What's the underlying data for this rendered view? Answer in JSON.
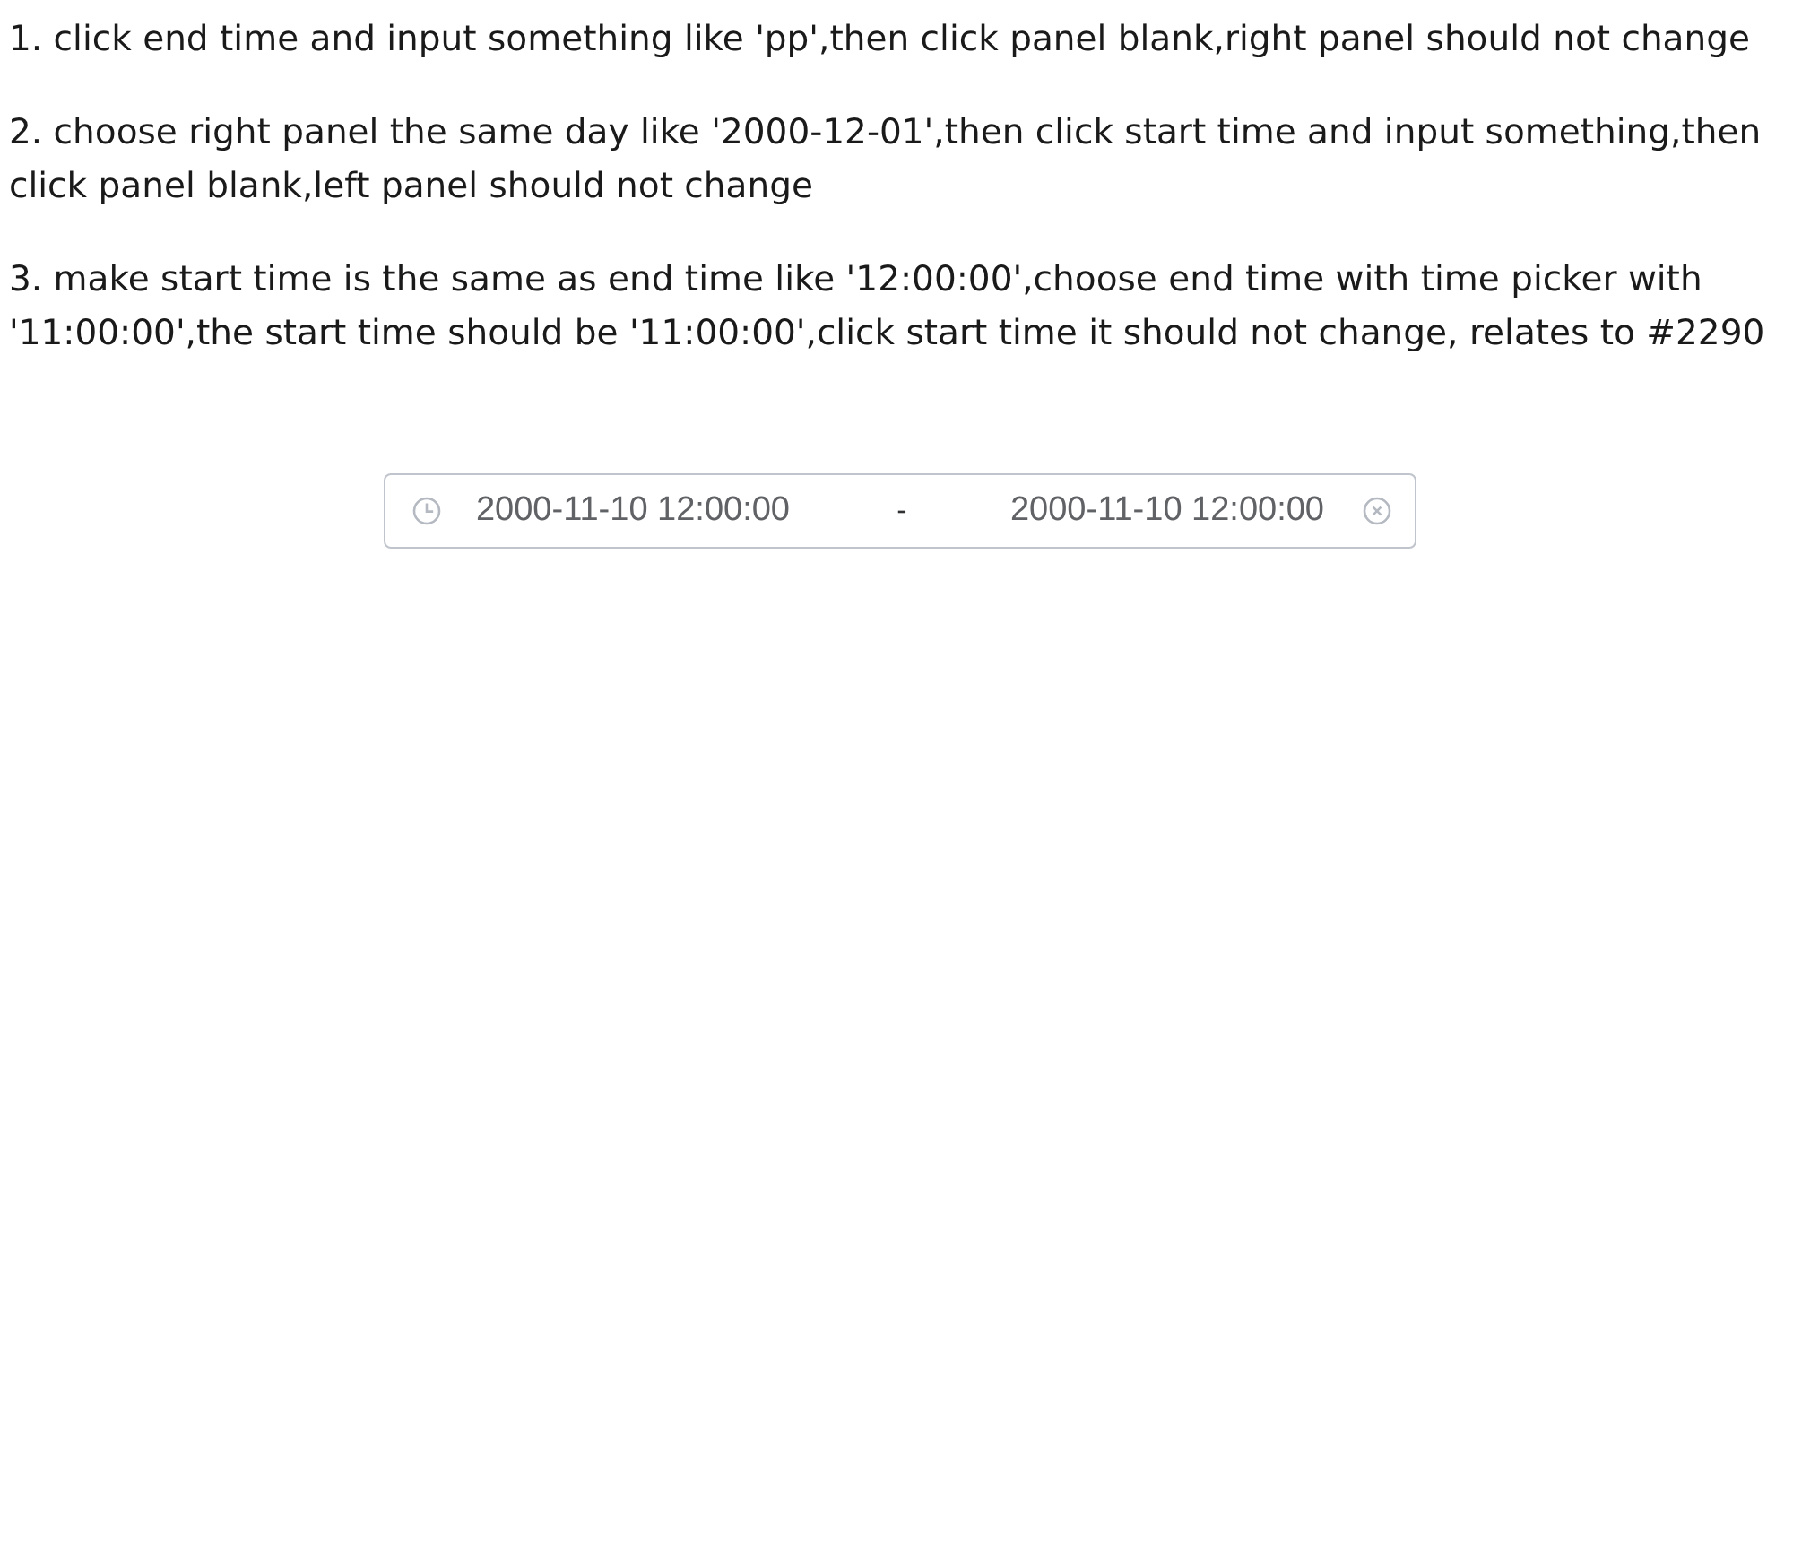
{
  "instructions": [
    "1. click end time and input something like 'pp',then click panel blank,right panel should not change",
    "2. choose right panel the same day like '2000-12-01',then click start time and input something,then click panel blank,left panel should not change",
    "3. make start time is the same as end time like '12:00:00',choose end time with time picker with '11:00:00',the start time should be '11:00:00',click start time it should not change, relates to #2290"
  ],
  "range_picker": {
    "start_value": "2000-11-10 12:00:00",
    "separator": "-",
    "end_value": "2000-11-10 12:00:00"
  }
}
